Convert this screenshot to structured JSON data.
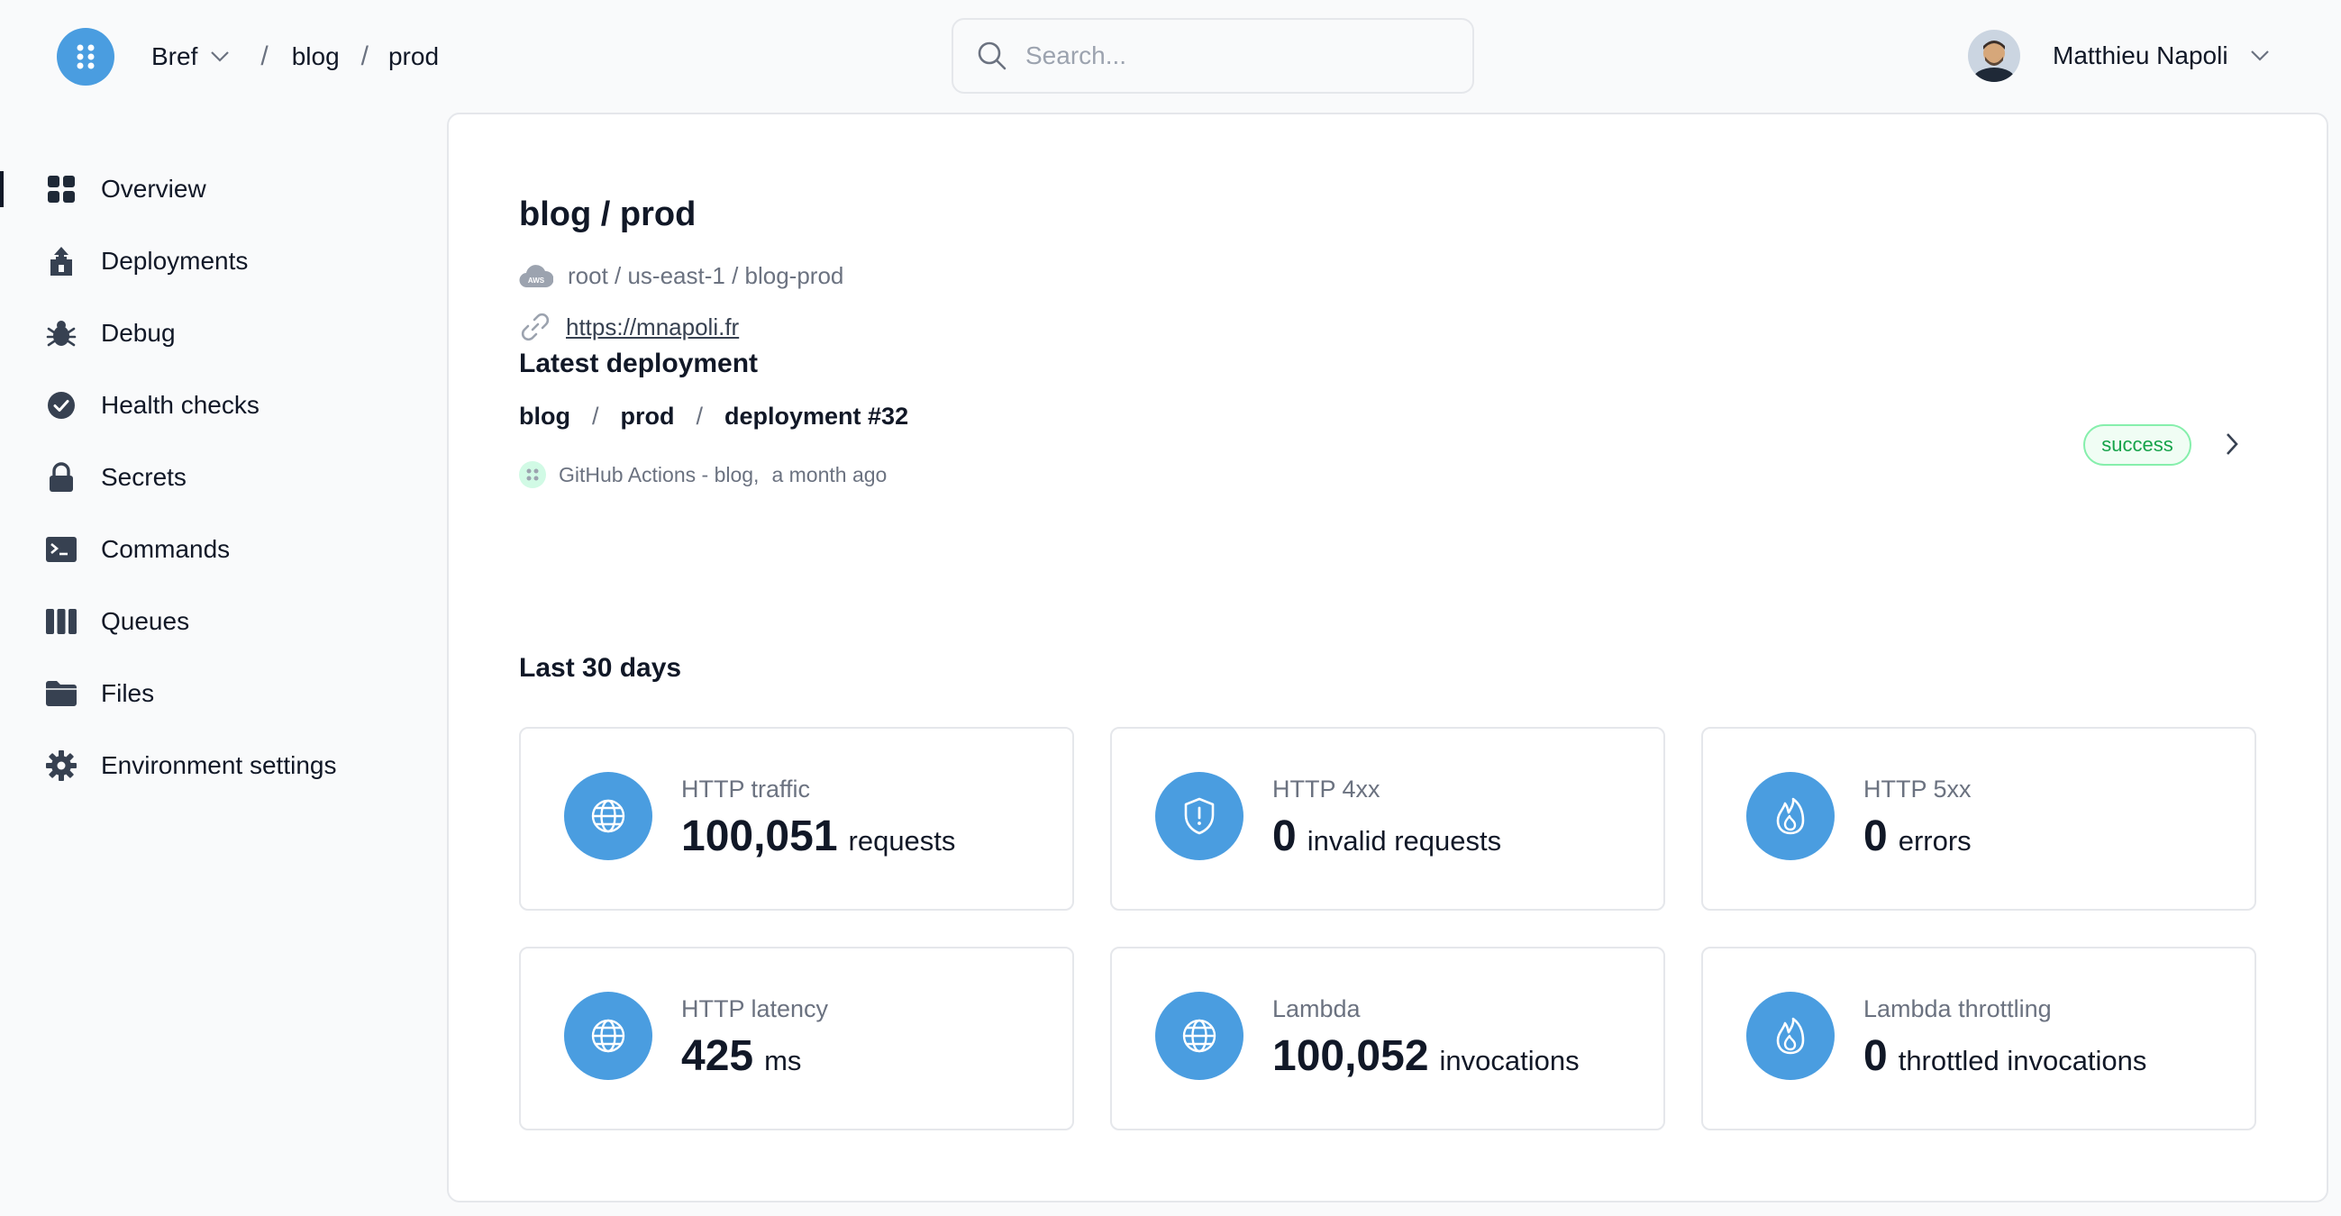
{
  "header": {
    "team": "Bref",
    "app": "blog",
    "env": "prod",
    "search_placeholder": "Search...",
    "user_name": "Matthieu Napoli"
  },
  "sidebar": {
    "items": [
      {
        "label": "Overview",
        "icon": "grid-icon"
      },
      {
        "label": "Deployments",
        "icon": "upload-icon"
      },
      {
        "label": "Debug",
        "icon": "bug-icon"
      },
      {
        "label": "Health checks",
        "icon": "check-circle-icon"
      },
      {
        "label": "Secrets",
        "icon": "lock-icon"
      },
      {
        "label": "Commands",
        "icon": "terminal-icon"
      },
      {
        "label": "Queues",
        "icon": "columns-icon"
      },
      {
        "label": "Files",
        "icon": "folder-icon"
      },
      {
        "label": "Environment settings",
        "icon": "gear-icon"
      }
    ]
  },
  "main": {
    "title": "blog / prod",
    "location": "root / us-east-1 / blog-prod",
    "url": "https://mnapoli.fr",
    "latest_deployment_heading": "Latest deployment",
    "deployment": {
      "app": "blog",
      "env": "prod",
      "name": "deployment #32",
      "source": "GitHub Actions - blog,",
      "time": "a month ago",
      "status": "success"
    },
    "last30_heading": "Last 30 days",
    "stats": [
      {
        "label": "HTTP traffic",
        "value": "100,051",
        "unit": "requests",
        "icon": "globe-icon"
      },
      {
        "label": "HTTP 4xx",
        "value": "0",
        "unit": "invalid requests",
        "icon": "shield-alert-icon"
      },
      {
        "label": "HTTP 5xx",
        "value": "0",
        "unit": "errors",
        "icon": "fire-icon"
      },
      {
        "label": "HTTP latency",
        "value": "425",
        "unit": "ms",
        "icon": "globe-icon"
      },
      {
        "label": "Lambda",
        "value": "100,052",
        "unit": "invocations",
        "icon": "globe-icon"
      },
      {
        "label": "Lambda throttling",
        "value": "0",
        "unit": "throttled invocations",
        "icon": "fire-icon"
      }
    ]
  },
  "colors": {
    "accent": "#4a9de0",
    "success": "#16a34a",
    "text": "#111827",
    "muted": "#6b7280"
  }
}
